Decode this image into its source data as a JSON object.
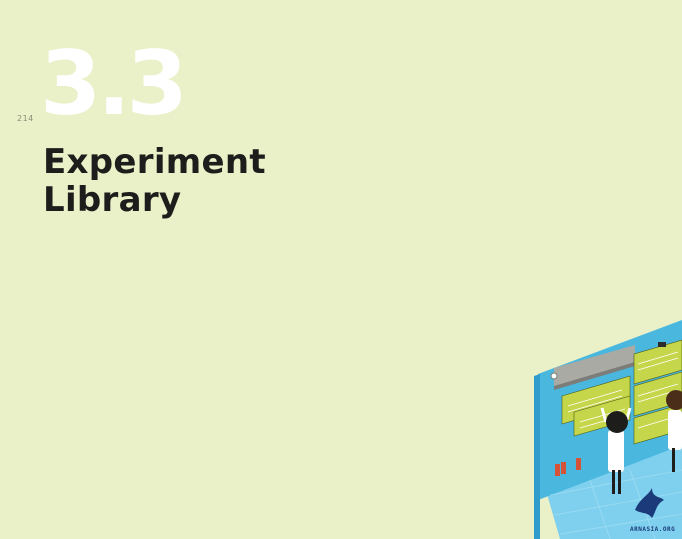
{
  "page": {
    "page_number": "214",
    "section_number": "3.3",
    "title_line1": "Experiment",
    "title_line2": "Library"
  },
  "illustration": {
    "watermark_text": "ARNASIA.ORG",
    "colors": {
      "wall": "#4ab7df",
      "floor": "#7fd0ee",
      "board": "#c6d64a",
      "rail": "#a9aaa4"
    }
  }
}
